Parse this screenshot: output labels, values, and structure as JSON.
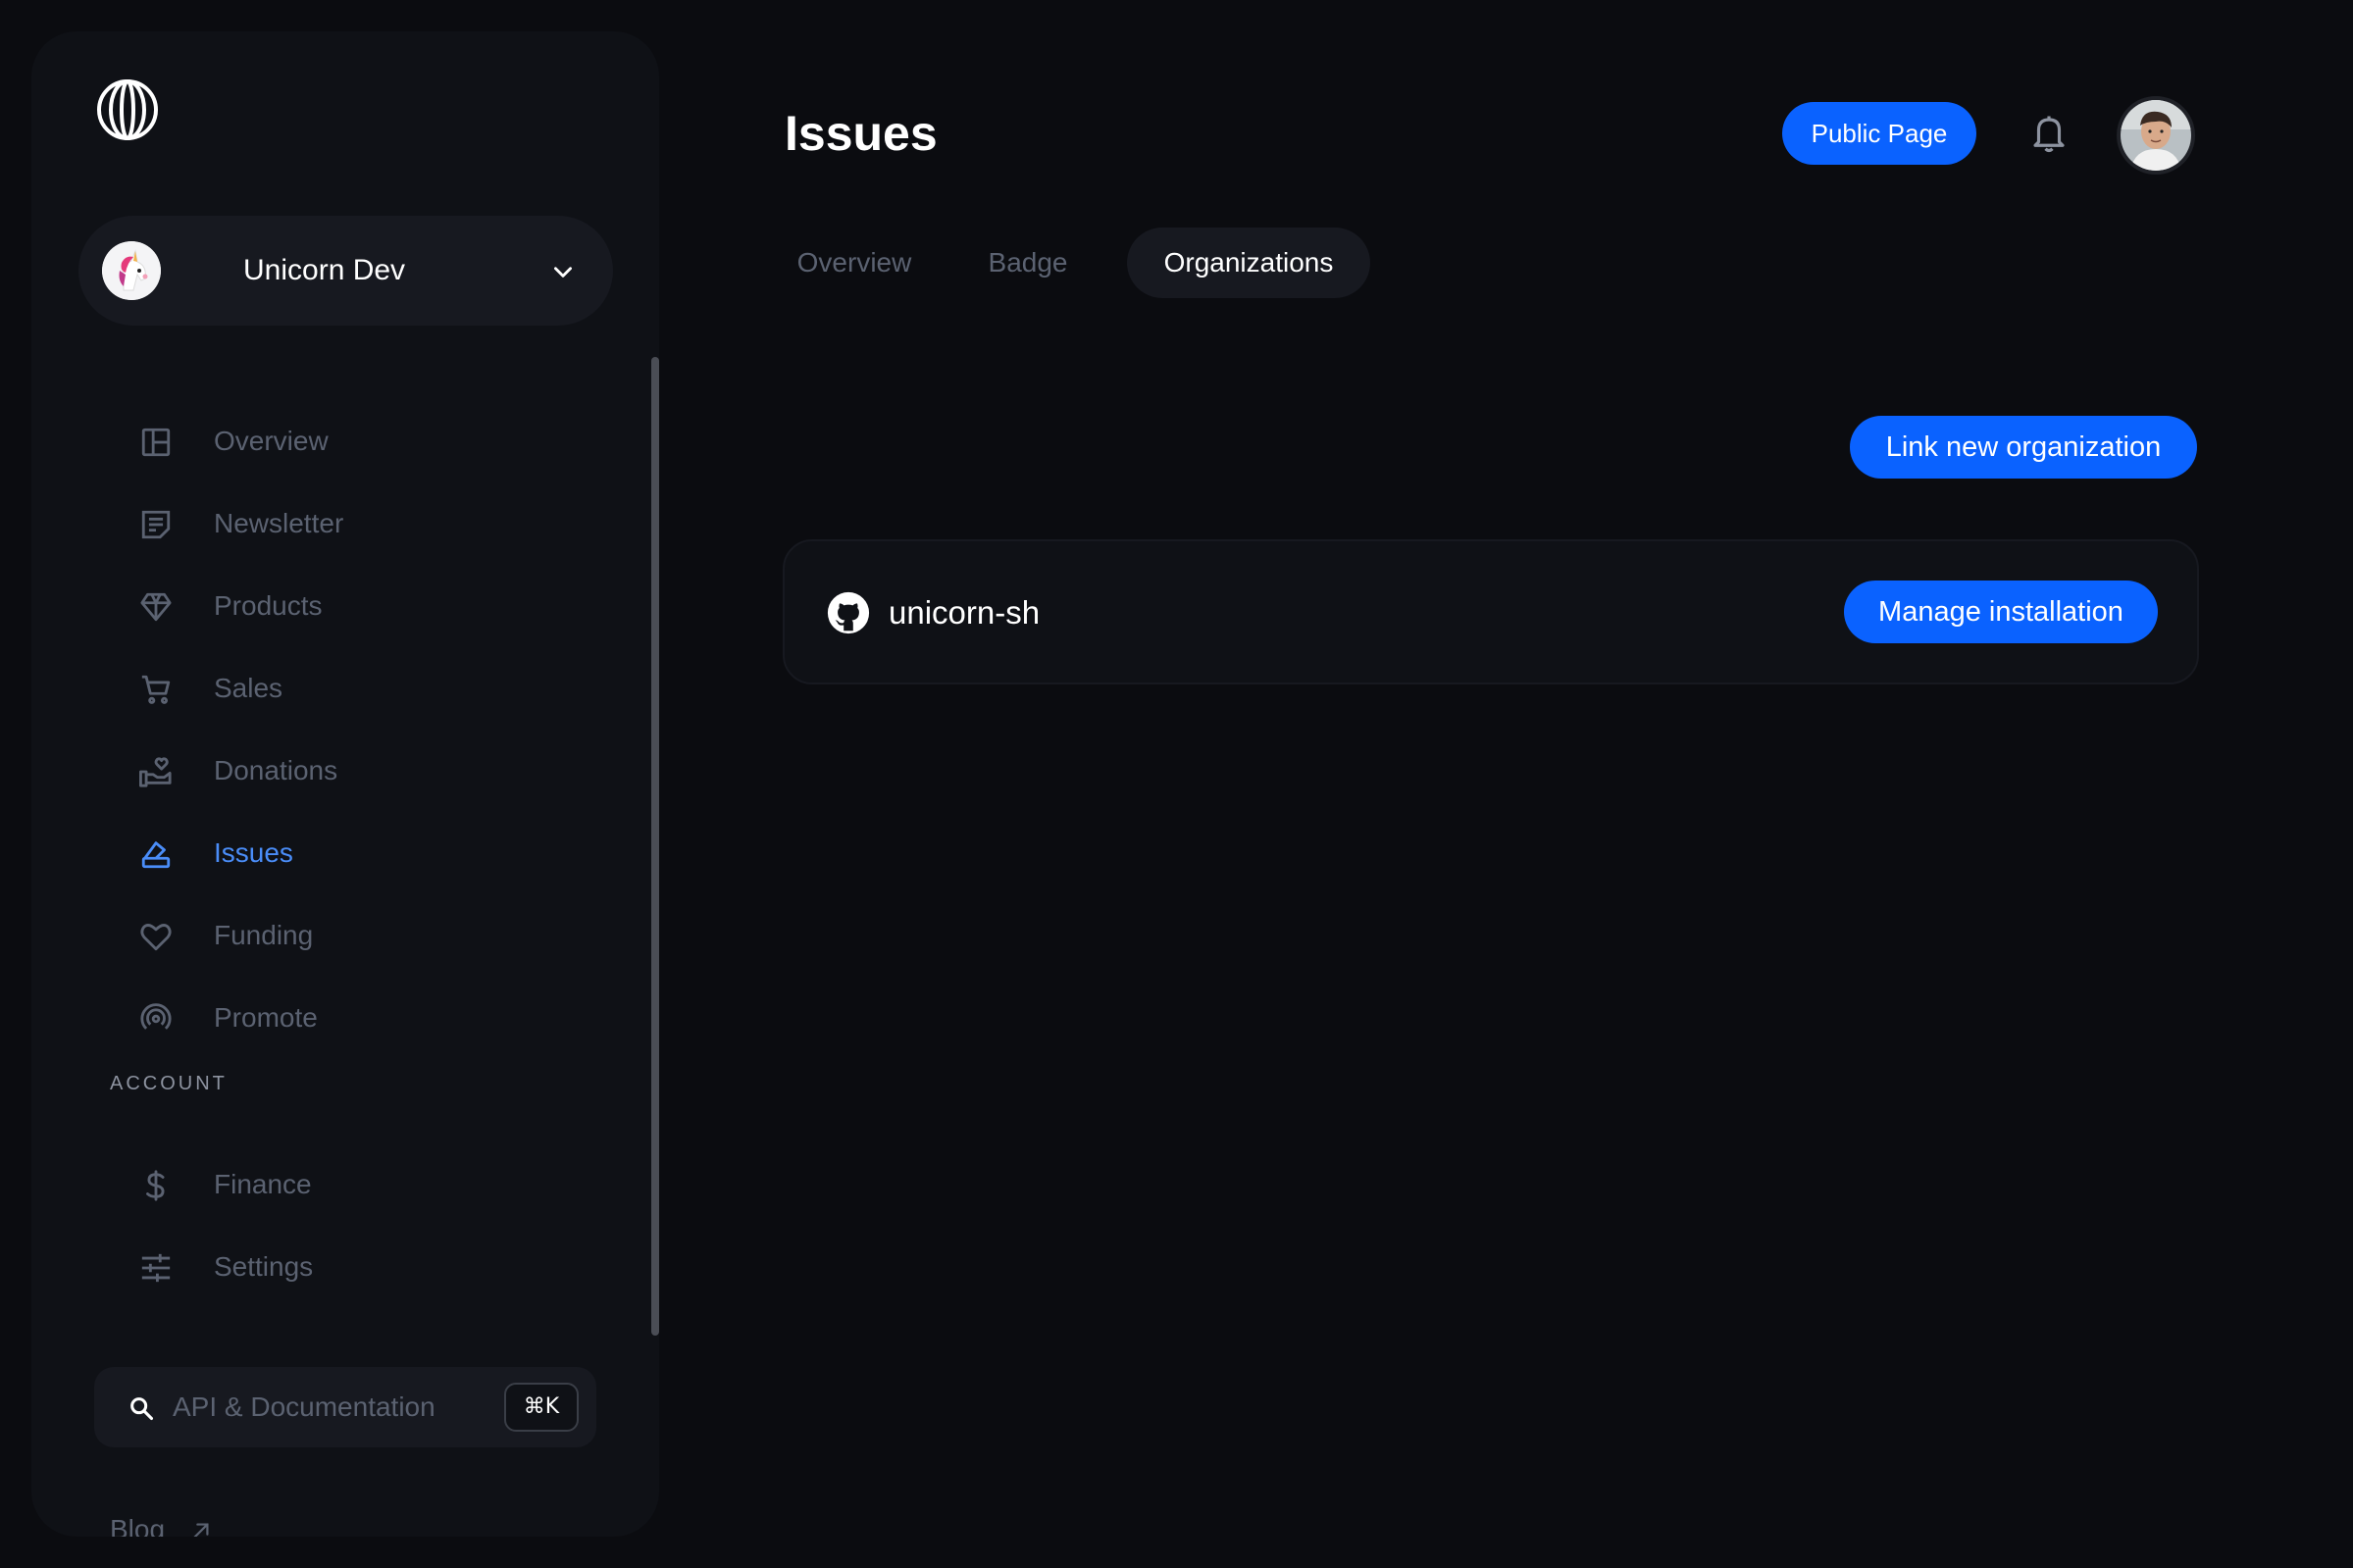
{
  "sidebar": {
    "org": {
      "name": "Unicorn Dev"
    },
    "nav": [
      {
        "label": "Overview",
        "icon": "layout-icon",
        "active": false
      },
      {
        "label": "Newsletter",
        "icon": "newsletter-icon",
        "active": false
      },
      {
        "label": "Products",
        "icon": "diamond-icon",
        "active": false
      },
      {
        "label": "Sales",
        "icon": "cart-icon",
        "active": false
      },
      {
        "label": "Donations",
        "icon": "hand-heart-icon",
        "active": false
      },
      {
        "label": "Issues",
        "icon": "bug-icon",
        "active": true
      },
      {
        "label": "Funding",
        "icon": "heart-icon",
        "active": false
      },
      {
        "label": "Promote",
        "icon": "broadcast-icon",
        "active": false
      }
    ],
    "account_label": "ACCOUNT",
    "account_nav": [
      {
        "label": "Finance",
        "icon": "dollar-icon"
      },
      {
        "label": "Settings",
        "icon": "sliders-icon"
      }
    ],
    "search": {
      "placeholder": "API & Documentation",
      "shortcut": "⌘K"
    },
    "blog_label": "Blog"
  },
  "header": {
    "title": "Issues",
    "public_page_label": "Public Page"
  },
  "tabs": [
    {
      "label": "Overview",
      "active": false
    },
    {
      "label": "Badge",
      "active": false
    },
    {
      "label": "Organizations",
      "active": true
    }
  ],
  "main": {
    "link_button_label": "Link new organization",
    "organizations": [
      {
        "name": "unicorn-sh",
        "icon": "github-icon",
        "action_label": "Manage installation"
      }
    ]
  },
  "colors": {
    "accent": "#0a62ff",
    "active_nav": "#4a8df8",
    "background": "#0b0c10",
    "sidebar": "#0f1116",
    "muted_text": "#5b6271"
  }
}
